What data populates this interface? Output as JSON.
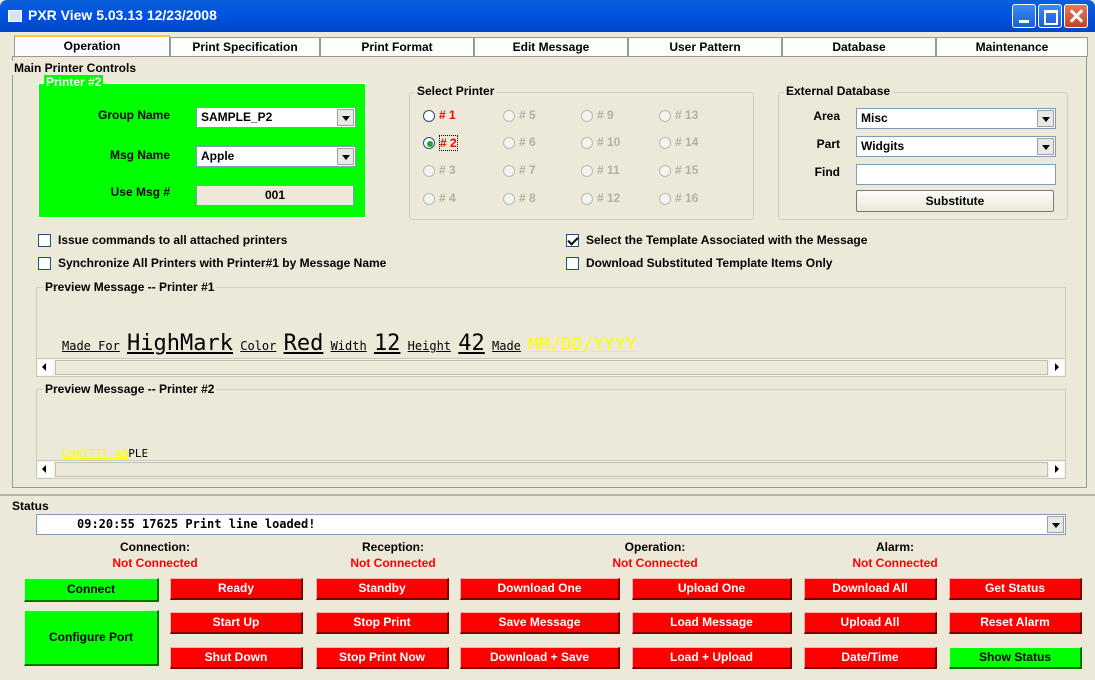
{
  "window": {
    "title": "PXR View 5.03.13 12/23/2008"
  },
  "tabs": [
    "Operation",
    "Print Specification",
    "Print Format",
    "Edit Message",
    "User Pattern",
    "Database",
    "Maintenance"
  ],
  "main": {
    "title": "Main Printer Controls",
    "printer": {
      "title": "Printer #2",
      "group_label": "Group Name",
      "group_value": "SAMPLE_P2",
      "msg_label": "Msg Name",
      "msg_value": "Apple",
      "usemsg_label": "Use Msg #",
      "usemsg_value": "001"
    },
    "select_printer": {
      "title": "Select Printer",
      "options": [
        "# 1",
        "# 5",
        "# 9",
        "# 13",
        "# 2",
        "# 6",
        "# 10",
        "# 14",
        "# 3",
        "# 7",
        "# 11",
        "# 15",
        "# 4",
        "# 8",
        "# 12",
        "# 16"
      ],
      "selected": "# 2"
    },
    "external_db": {
      "title": "External Database",
      "area_label": "Area",
      "area_value": "Misc",
      "part_label": "Part",
      "part_value": "Widgits",
      "find_label": "Find",
      "find_value": "",
      "substitute_label": "Substitute"
    },
    "checks": {
      "issue_all": "Issue commands to all attached printers",
      "sync_all": "Synchronize All Printers with Printer#1 by Message Name",
      "select_template": "Select the Template Associated with the Message",
      "download_subst": "Download Substituted Template Items Only"
    },
    "preview1": {
      "title": "Preview Message -- Printer #1",
      "items": [
        "Made For",
        "HighMark",
        "Color",
        "Red",
        "Width",
        "12",
        "Height",
        "42",
        "Made",
        "MM/DD/YYYY"
      ]
    },
    "preview2": {
      "title": "Preview Message -- Printer #2",
      "items": [
        "CHXYTTT AB",
        "PLE"
      ]
    }
  },
  "status": {
    "title": "Status",
    "log_line": "09:20:55 17625 Print line loaded!",
    "connection_label": "Connection:",
    "connection_value": "Not Connected",
    "reception_label": "Reception:",
    "reception_value": "Not Connected",
    "operation_label": "Operation:",
    "operation_value": "Not Connected",
    "alarm_label": "Alarm:",
    "alarm_value": "Not Connected"
  },
  "buttons": {
    "connect": "Connect",
    "configure_port": "Configure Port",
    "ready": "Ready",
    "standby": "Standby",
    "download_one": "Download One",
    "upload_one": "Upload One",
    "download_all": "Download All",
    "get_status": "Get Status",
    "start_up": "Start Up",
    "stop_print": "Stop Print",
    "save_message": "Save Message",
    "load_message": "Load Message",
    "upload_all": "Upload All",
    "reset_alarm": "Reset Alarm",
    "shut_down": "Shut Down",
    "stop_print_now": "Stop Print Now",
    "download_save": "Download + Save",
    "load_upload": "Load + Upload",
    "date_time": "Date/Time",
    "show_status": "Show Status"
  },
  "colors": {
    "green": "#00ff00",
    "red": "#ff0000",
    "yellow": "#ffff00",
    "xp_title": "#0053e1"
  }
}
